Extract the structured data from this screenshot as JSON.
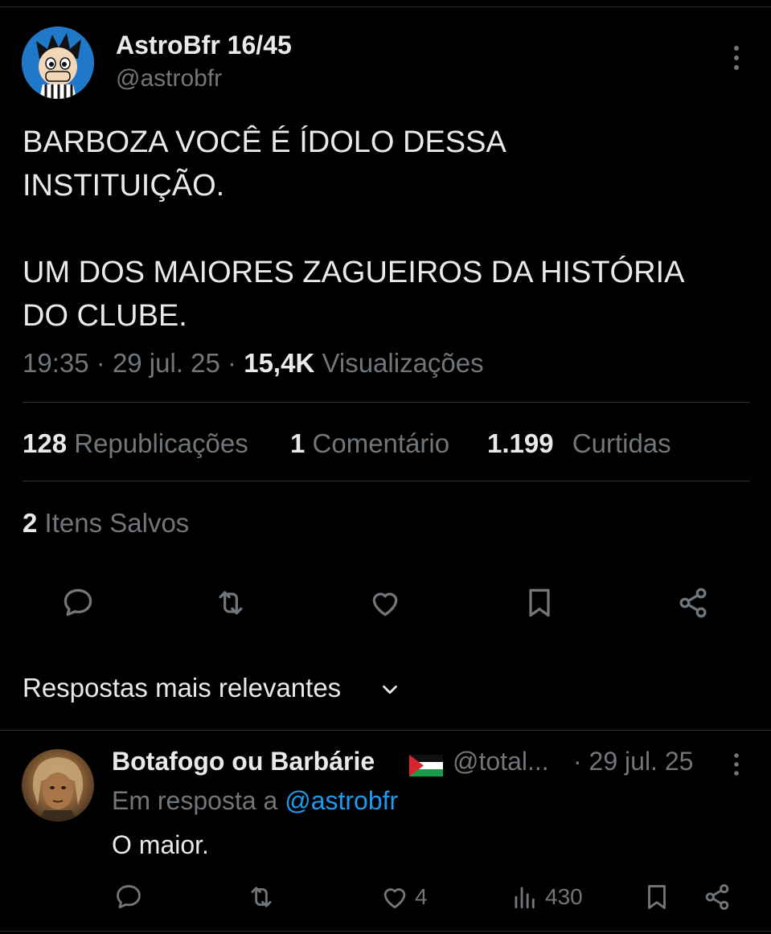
{
  "tweet": {
    "author_name": "AstroBfr 16/45",
    "author_handle": "@astrobfr",
    "text": "BARBOZA VOCÊ É ÍDOLO DESSA\nINSTITUIÇÃO.\n\nUM DOS MAIORES ZAGUEIROS DA HISTÓRIA\nDO CLUBE.",
    "time": "19:35",
    "date": "29 jul. 25",
    "views_count": "15,4K",
    "views_label": "Visualizações",
    "reposts_count": "128",
    "reposts_label": "Republicações",
    "comments_count": "1",
    "comments_label": "Comentário",
    "likes_count": "1.199",
    "likes_label": "Curtidas",
    "saved_count": "2",
    "saved_label": "Itens Salvos"
  },
  "actions": [
    "reply-icon",
    "repost-icon",
    "like-icon",
    "bookmark-icon",
    "share-icon"
  ],
  "replies_sort_label": "Respostas mais relevantes",
  "reply": {
    "author_name": "Botafogo ou Barbárie",
    "author_handle": "@total...",
    "date": "· 29 jul. 25",
    "in_reply_prefix": "Em resposta a",
    "in_reply_handle": "@astrobfr",
    "text": "O maior.",
    "likes": "4",
    "views": "430"
  },
  "colors": {
    "background": "#000000",
    "text": "#e7e9ea",
    "muted": "#71767b",
    "link": "#1d9bf0",
    "divider": "#2f3336"
  }
}
